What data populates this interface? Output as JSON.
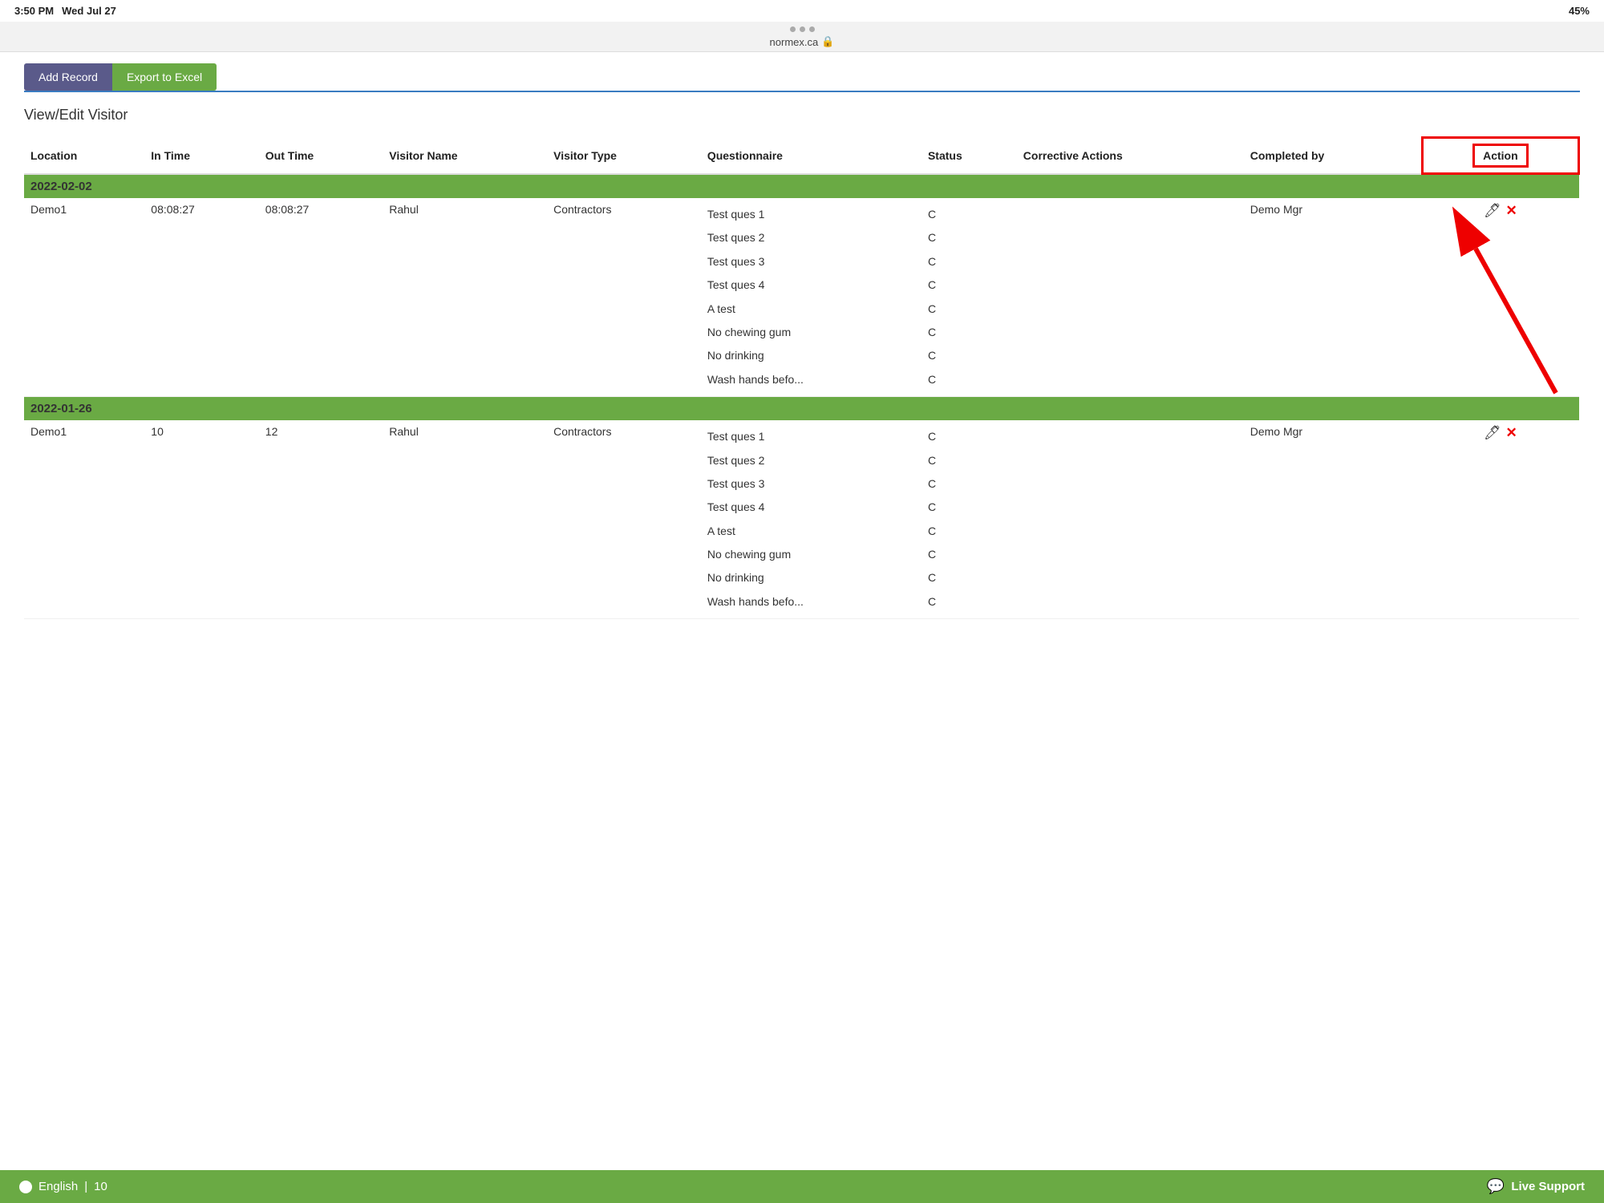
{
  "statusBar": {
    "time": "3:50 PM",
    "date": "Wed Jul 27",
    "url": "normex.ca",
    "battery": "45%"
  },
  "toolbar": {
    "addRecord": "Add Record",
    "exportExcel": "Export to Excel"
  },
  "pageTitle": "View/Edit Visitor",
  "table": {
    "headers": {
      "location": "Location",
      "inTime": "In Time",
      "outTime": "Out Time",
      "visitorName": "Visitor Name",
      "visitorType": "Visitor Type",
      "questionnaire": "Questionnaire",
      "status": "Status",
      "correctiveActions": "Corrective Actions",
      "completedBy": "Completed by",
      "action": "Action"
    },
    "groups": [
      {
        "date": "2022-02-02",
        "rows": [
          {
            "location": "Demo1",
            "inTime": "08:08:27",
            "outTime": "08:08:27",
            "visitorName": "Rahul",
            "visitorType": "Contractors",
            "questionnaire": [
              "Test ques 1",
              "Test ques 2",
              "Test ques 3",
              "Test ques 4",
              "A test",
              "No chewing gum",
              "No drinking",
              "Wash hands befo..."
            ],
            "statuses": [
              "C",
              "C",
              "C",
              "C",
              "C",
              "C",
              "C",
              "C"
            ],
            "correctiveActions": "",
            "completedBy": "Demo Mgr",
            "hasEditIcon": true,
            "hasDeleteIcon": true
          }
        ]
      },
      {
        "date": "2022-01-26",
        "rows": [
          {
            "location": "Demo1",
            "inTime": "10",
            "outTime": "12",
            "visitorName": "Rahul",
            "visitorType": "Contractors",
            "questionnaire": [
              "Test ques 1",
              "Test ques 2",
              "Test ques 3",
              "Test ques 4",
              "A test",
              "No chewing gum",
              "No drinking",
              "Wash hands befo..."
            ],
            "statuses": [
              "C",
              "C",
              "C",
              "C",
              "C",
              "C",
              "C",
              "C"
            ],
            "correctiveActions": "",
            "completedBy": "Demo Mgr",
            "hasEditIcon": true,
            "hasDeleteIcon": true
          }
        ]
      }
    ]
  },
  "bottomBar": {
    "language": "English",
    "counter": "10",
    "liveSupport": "Live Support"
  },
  "icons": {
    "editIcon": "🖊",
    "deleteIcon": "✕",
    "chatIcon": "💬"
  }
}
